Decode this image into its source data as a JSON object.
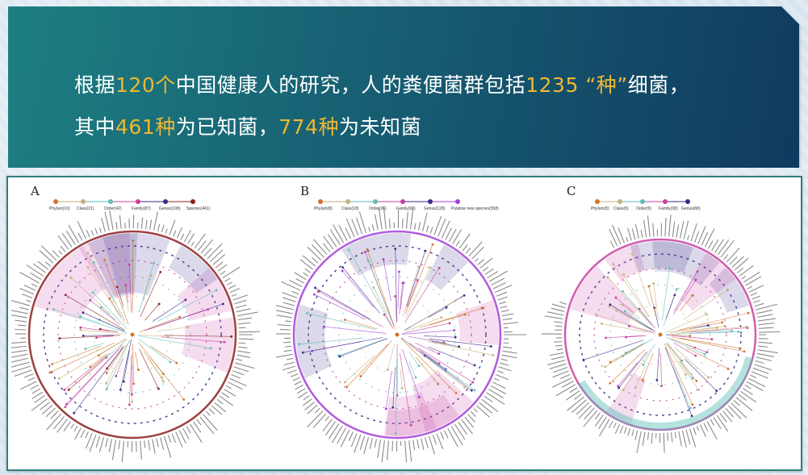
{
  "banner": {
    "line1": {
      "t1": "根据",
      "h1": "120个",
      "t2": "中国健康人的研究，人的粪便菌群包括",
      "h2": "1235 “种”",
      "t3": "细菌，"
    },
    "line2": {
      "t1": "其中",
      "h1": "461种",
      "t2": "为已知菌，",
      "h2": "774种",
      "t3": "为未知菌"
    }
  },
  "colors": {
    "highlight": "#f0b732",
    "phylum": "#d2732a",
    "class": "#c8b07a",
    "order": "#5bbfb7",
    "family": "#c83fa0",
    "genus": "#3a2a8a",
    "species": "#8b2020",
    "putative": "#a23fd8"
  },
  "figures": [
    {
      "letter": "A",
      "legend": [
        "Phylum(10)",
        "Class(21)",
        "Order(42)",
        "Family(87)",
        "Genus(198)",
        "Species(461)"
      ],
      "legend_colors": [
        "#d2732a",
        "#c8b07a",
        "#5bbfb7",
        "#c83fa0",
        "#3a2a8a",
        "#8b2020"
      ],
      "outer_ring": "#8b2020"
    },
    {
      "letter": "B",
      "legend": [
        "Phylum(8)",
        "Class(18)",
        "Order(36)",
        "Family(68)",
        "Genus(128)",
        "Putative new species(358)"
      ],
      "legend_colors": [
        "#d2732a",
        "#c8b07a",
        "#5bbfb7",
        "#c83fa0",
        "#3a2a8a",
        "#a23fd8"
      ],
      "outer_ring": "#a23fd8"
    },
    {
      "letter": "C",
      "legend": [
        "Phylum(5)",
        "Class(9)",
        "Order(9)",
        "Family(38)",
        "Genus(68)"
      ],
      "legend_colors": [
        "#d2732a",
        "#c8b07a",
        "#5bbfb7",
        "#c83fa0",
        "#3a2a8a"
      ],
      "outer_ring": "#c83fa0"
    }
  ]
}
